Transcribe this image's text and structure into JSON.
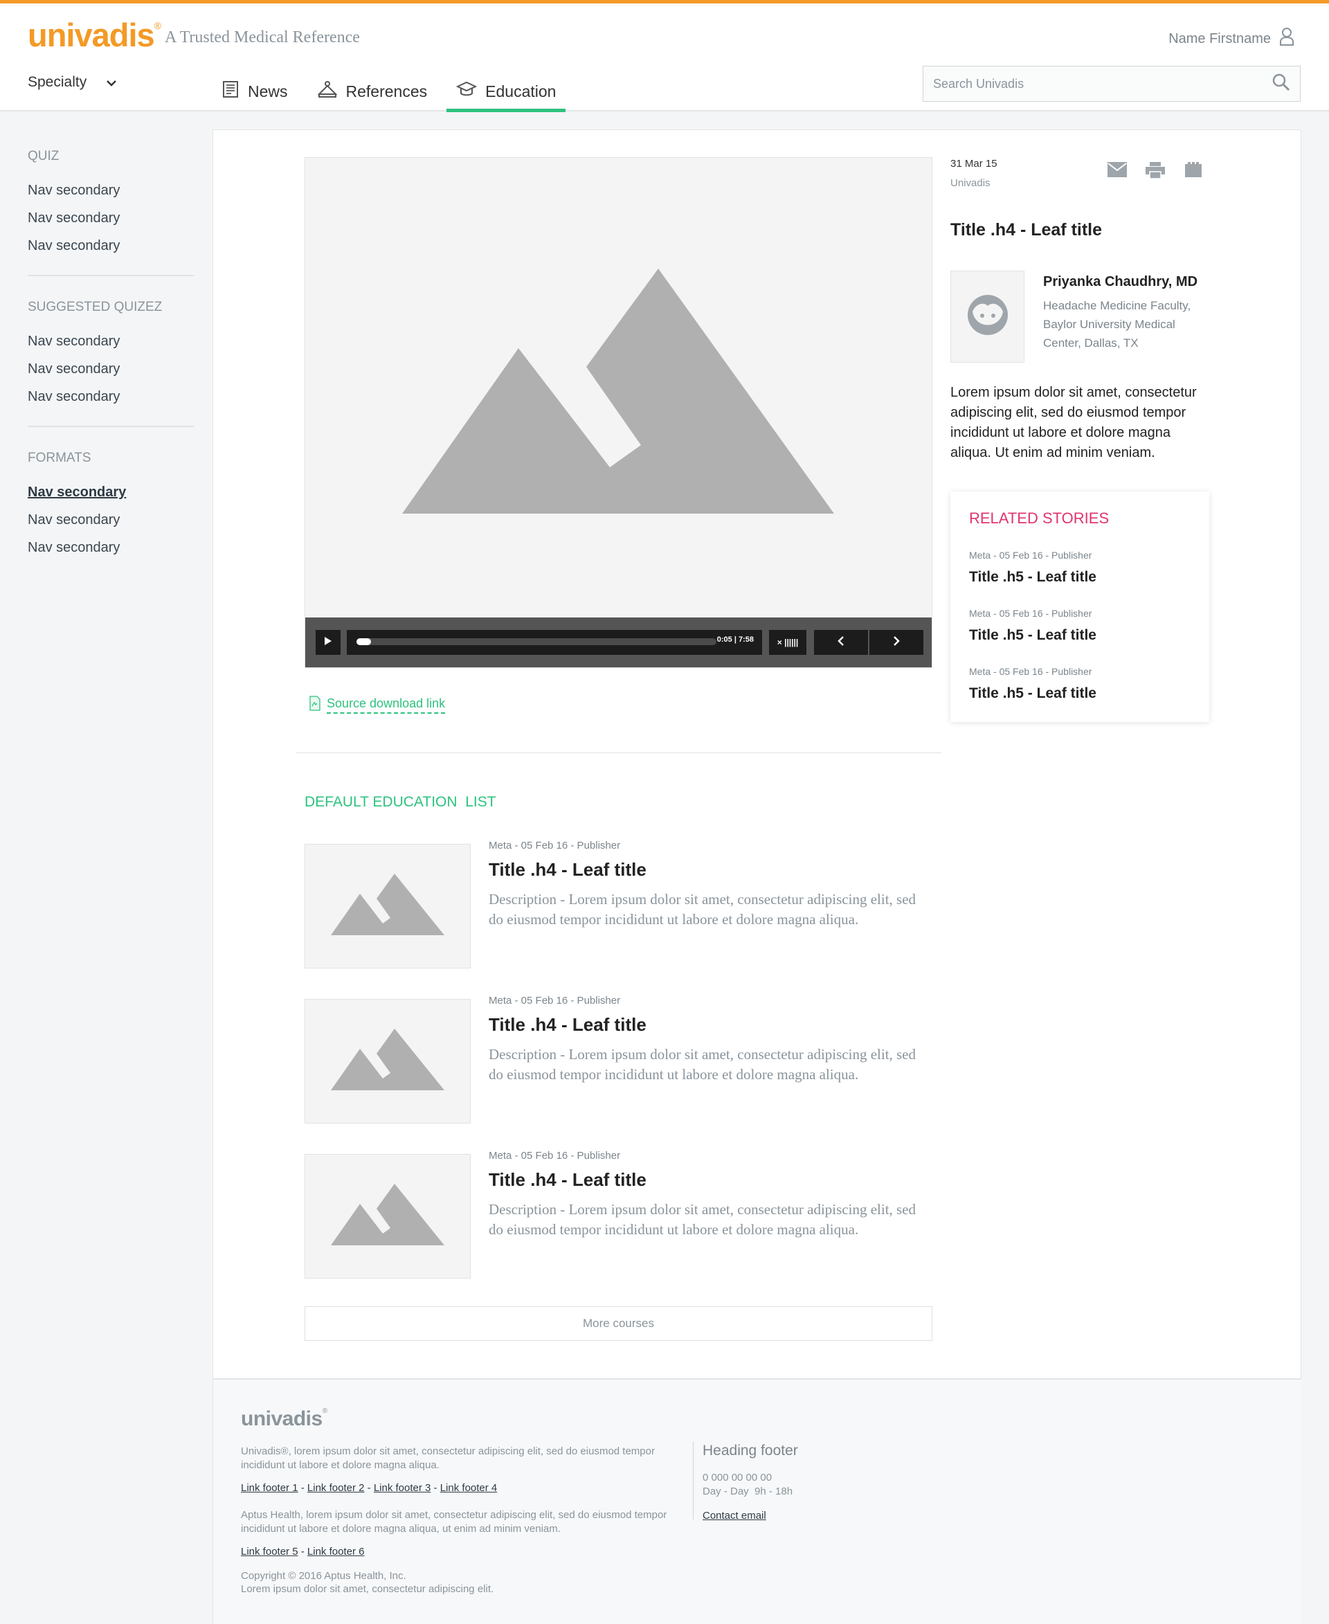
{
  "brand": {
    "logo": "univadis",
    "reg": "®",
    "tagline": "A Trusted Medical Reference",
    "accent": "#f39a26",
    "green": "#2ec27e",
    "pink": "#e0356e"
  },
  "header": {
    "user_name": "Name Firstname",
    "specialty_label": "Specialty",
    "nav": [
      {
        "label": "News",
        "icon": "newspaper-icon"
      },
      {
        "label": "References",
        "icon": "book-icon"
      },
      {
        "label": "Education",
        "icon": "graduation-cap-icon",
        "active": true
      }
    ],
    "search_placeholder": "Search Univadis"
  },
  "sidebar": {
    "sections": [
      {
        "heading": "QUIZ",
        "items": [
          "Nav secondary",
          "Nav secondary",
          "Nav secondary"
        ]
      },
      {
        "heading": "SUGGESTED QUIZEZ",
        "items": [
          "Nav secondary",
          "Nav secondary",
          "Nav secondary"
        ]
      },
      {
        "heading": "FORMATS",
        "items": [
          "Nav secondary",
          "Nav secondary",
          "Nav secondary"
        ],
        "current_index": 0
      }
    ]
  },
  "video": {
    "progress": 0.04,
    "time": "0:05 | 7:58",
    "quality": "× ||||||"
  },
  "source_link": "Source download link",
  "article": {
    "date": "31 Mar 15",
    "publisher": "Univadis",
    "title": "Title .h4 - Leaf title",
    "author_name": "Priyanka Chaudhry, MD",
    "author_affiliation": "Headache Medicine Faculty, Baylor University Medical Center, Dallas, TX",
    "lede": "Lorem ipsum dolor sit amet, consectetur adipiscing elit, sed do eiusmod tempor incididunt ut labore et dolore magna aliqua. Ut enim ad minim veniam."
  },
  "related": {
    "heading": "RELATED STORIES",
    "items": [
      {
        "meta": "Meta - 05 Feb 16 - Publisher",
        "title": "Title .h5 - Leaf title"
      },
      {
        "meta": "Meta - 05 Feb 16 - Publisher",
        "title": "Title .h5 - Leaf title"
      },
      {
        "meta": "Meta - 05 Feb 16 - Publisher",
        "title": "Title .h5 - Leaf title"
      }
    ]
  },
  "education_list": {
    "heading": "DEFAULT EDUCATION  LIST",
    "items": [
      {
        "meta": "Meta - 05 Feb 16 - Publisher",
        "title": "Title .h4 - Leaf title",
        "description": "Description - Lorem ipsum dolor sit amet, consectetur adipiscing elit, sed do eiusmod tempor incididunt ut labore et dolore magna aliqua."
      },
      {
        "meta": "Meta - 05 Feb 16 - Publisher",
        "title": "Title .h4 - Leaf title",
        "description": "Description - Lorem ipsum dolor sit amet, consectetur adipiscing elit, sed do eiusmod tempor incididunt ut labore et dolore magna aliqua."
      },
      {
        "meta": "Meta - 05 Feb 16 - Publisher",
        "title": "Title .h4 - Leaf title",
        "description": "Description - Lorem ipsum dolor sit amet, consectetur adipiscing elit, sed do eiusmod tempor incididunt ut labore et dolore magna aliqua."
      }
    ],
    "more_label": "More courses"
  },
  "footer": {
    "logo": "univadis",
    "reg": "®",
    "text1": "Univadis®, lorem ipsum dolor sit amet, consectetur adipiscing elit, sed do eiusmod tempor incididunt ut labore et dolore magna aliqua.",
    "links1": [
      "Link footer 1",
      "Link footer 2",
      "Link footer 3",
      "Link footer 4"
    ],
    "text2": "Aptus Health, lorem ipsum dolor sit amet, consectetur adipiscing elit, sed do eiusmod tempor incididunt ut labore et dolore magna aliqua, ut enim ad minim veniam.",
    "links2": [
      "Link footer 5",
      "Link footer 6"
    ],
    "copyright": "Copyright © 2016 Aptus Health, Inc.",
    "copyright2": "Lorem ipsum dolor sit amet, consectetur adipiscing elit.",
    "heading": "Heading footer",
    "phone": "0 000 00 00 00",
    "hours": "Day - Day  9h - 18h",
    "contact": "Contact email"
  }
}
